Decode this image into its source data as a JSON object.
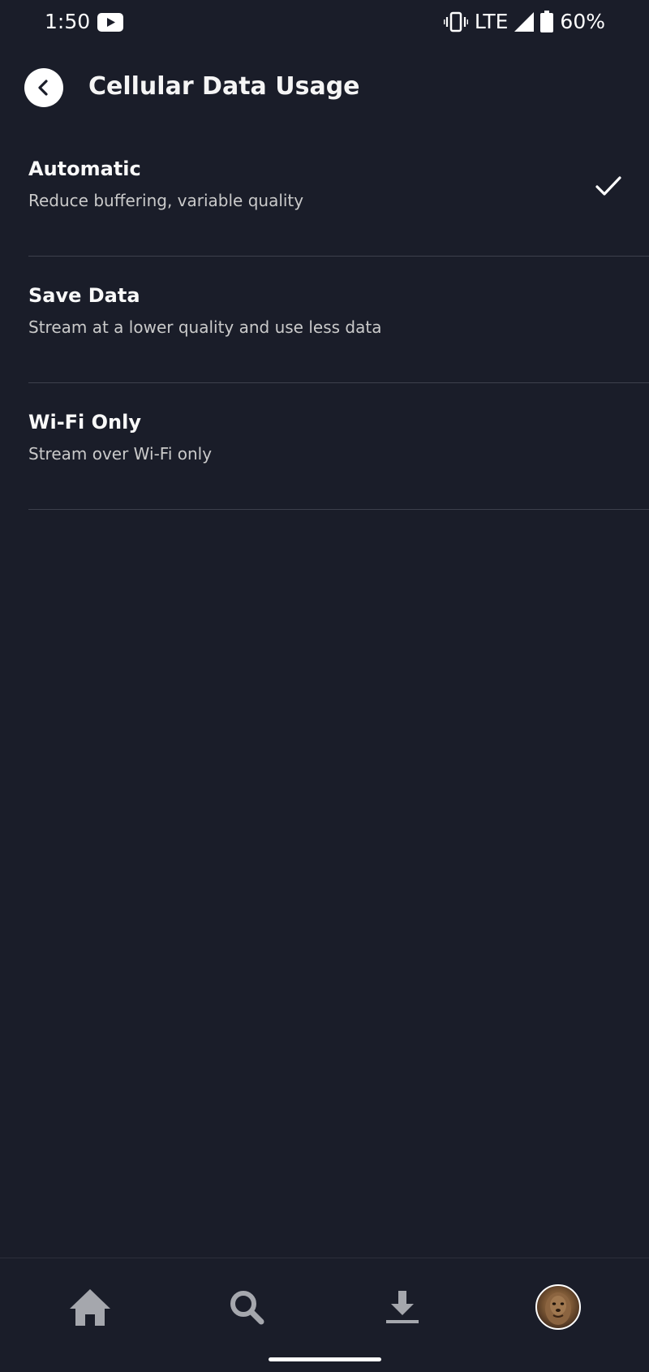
{
  "status_bar": {
    "time": "1:50",
    "network": "LTE",
    "battery": "60%"
  },
  "header": {
    "title": "Cellular Data Usage"
  },
  "options": [
    {
      "title": "Automatic",
      "description": "Reduce buffering, variable quality",
      "selected": true
    },
    {
      "title": "Save Data",
      "description": "Stream at a lower quality and use less data",
      "selected": false
    },
    {
      "title": "Wi-Fi Only",
      "description": "Stream over Wi-Fi only",
      "selected": false
    }
  ],
  "bottom_nav": {
    "items": [
      {
        "icon": "home-icon"
      },
      {
        "icon": "search-icon"
      },
      {
        "icon": "download-icon"
      },
      {
        "icon": "profile-avatar"
      }
    ]
  },
  "colors": {
    "background": "#1a1d29",
    "divider": "#3d404c",
    "nav_icon": "#a5a7ad"
  }
}
